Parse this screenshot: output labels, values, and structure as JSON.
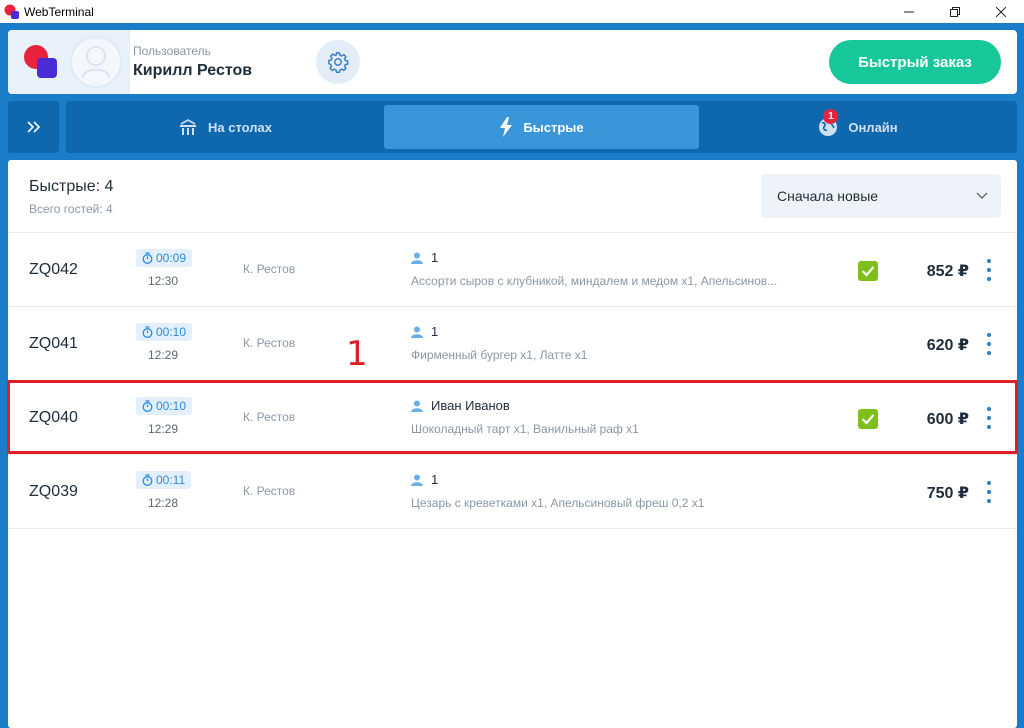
{
  "window": {
    "title": "WebTerminal",
    "controls": [
      "minimize",
      "maximize",
      "close"
    ]
  },
  "header": {
    "user_label": "Пользователь",
    "user_name": "Кирилл Рестов",
    "quick_order_label": "Быстрый заказ"
  },
  "nav": {
    "toggle_icon": "double-chevron-right-icon",
    "tabs": [
      {
        "label": "На столах",
        "icon": "tables-icon",
        "active": false
      },
      {
        "label": "Быстрые",
        "icon": "lightning-icon",
        "active": true
      },
      {
        "label": "Онлайн",
        "icon": "globe-icon",
        "active": false,
        "badge": "1"
      }
    ]
  },
  "list": {
    "title": "Быстрые: 4",
    "subtitle": "Всего гостей: 4",
    "sort": {
      "selected": "Сначала новые"
    },
    "orders": [
      {
        "code": "ZQ042",
        "timer": "00:09",
        "time": "12:30",
        "waiter": "К. Рестов",
        "guest": "1",
        "items": "Ассорти сыров с клубникой, миндалем и медом x1, Апельсинов...",
        "paid": true,
        "price": "852 ₽",
        "highlighted": false
      },
      {
        "code": "ZQ041",
        "timer": "00:10",
        "time": "12:29",
        "waiter": "К. Рестов",
        "guest": "1",
        "items": "Фирменный бургер x1, Латте x1",
        "paid": false,
        "price": "620 ₽",
        "highlighted": false
      },
      {
        "code": "ZQ040",
        "timer": "00:10",
        "time": "12:29",
        "waiter": "К. Рестов",
        "guest": "Иван Иванов",
        "items": "Шоколадный тарт x1, Ванильный раф x1",
        "paid": true,
        "price": "600 ₽",
        "highlighted": true
      },
      {
        "code": "ZQ039",
        "timer": "00:11",
        "time": "12:28",
        "waiter": "К. Рестов",
        "guest": "1",
        "items": "Цезарь с креветками x1, Апельсиновый фреш 0,2 x1",
        "paid": false,
        "price": "750 ₽",
        "highlighted": false
      }
    ]
  },
  "annotation": "1",
  "colors": {
    "accent_blue": "#1a7dc9",
    "quick_order_green": "#16c79a",
    "check_green": "#7fbf1b",
    "highlight_red": "#e01e26"
  }
}
